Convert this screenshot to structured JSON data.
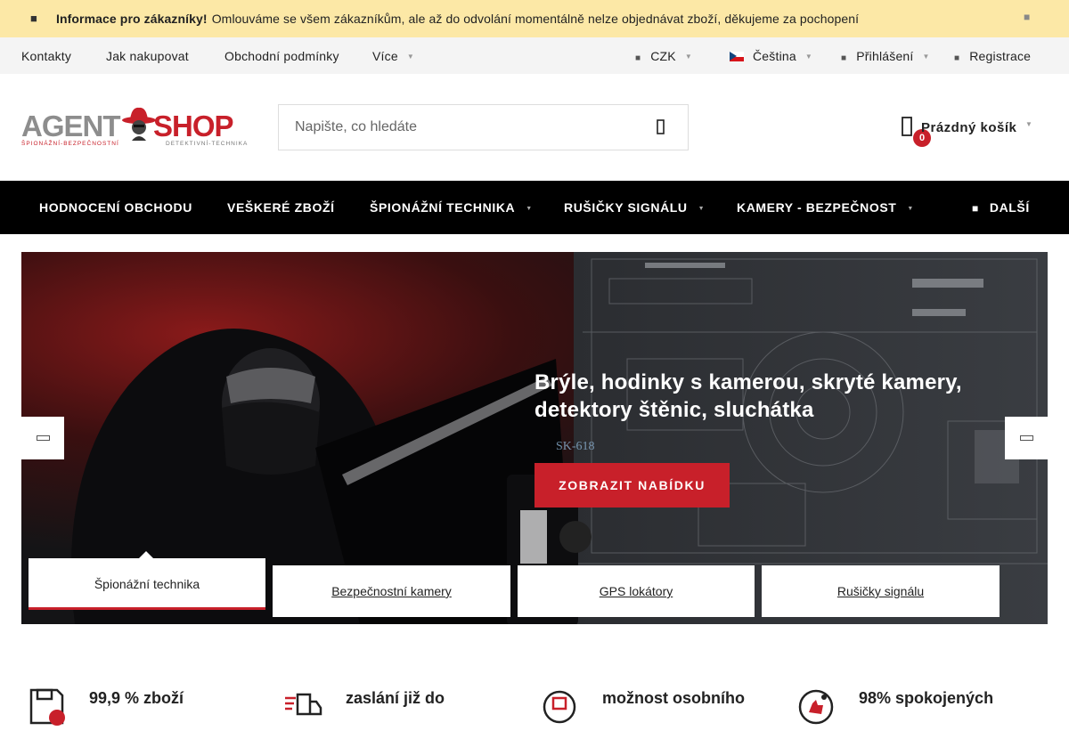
{
  "notice": {
    "icon": "info-icon",
    "title": "Informace pro zákazníky!",
    "message": "Omlouváme se všem zákazníkům, ale až do odvolání momentálně nelze objednávat zboží, děkujeme za pochopení",
    "close_icon": "close-icon"
  },
  "topbar": {
    "links": [
      "Kontakty",
      "Jak nakupovat",
      "Obchodní podmínky",
      "Více"
    ],
    "currency": "CZK",
    "language": "Čeština",
    "login": "Přihlášení",
    "register": "Registrace"
  },
  "logo": {
    "word1": "AGENT",
    "word2": "SHOP",
    "tagline1": "ŠPIONÁŽNÍ-BEZPEČNOSTNÍ",
    "tagline2": "DETEKTIVNÍ-TECHNIKA"
  },
  "search": {
    "placeholder": "Napište, co hledáte"
  },
  "cart": {
    "label": "Prázdný košík",
    "count": "0",
    "badge_color": "#c8202a"
  },
  "mainnav": {
    "items": [
      "HODNOCENÍ OBCHODU",
      "VEŠKERÉ ZBOŽÍ",
      "ŠPIONÁŽNÍ TECHNIKA",
      "RUŠIČKY SIGNÁLU",
      "KAMERY - BEZPEČNOST"
    ],
    "more": "DALŠÍ"
  },
  "hero": {
    "title": "Brýle, hodinky s kamerou, skryté kamery, detektory štěnic, sluchátka",
    "button": "ZOBRAZIT NABÍDKU",
    "accent": "#c8202a",
    "tabs": [
      "Špionážní technika",
      "Bezpečnostní kamery",
      "GPS lokátory",
      "Rušičky signálu"
    ],
    "active_tab": 0
  },
  "benefits": [
    {
      "icon": "save-icon",
      "text": "99,9 % zboží"
    },
    {
      "icon": "delivery-icon",
      "text": "zaslání již do"
    },
    {
      "icon": "store-icon",
      "text": "možnost osobního"
    },
    {
      "icon": "thumbs-up-icon",
      "text": "98% spokojených"
    }
  ]
}
